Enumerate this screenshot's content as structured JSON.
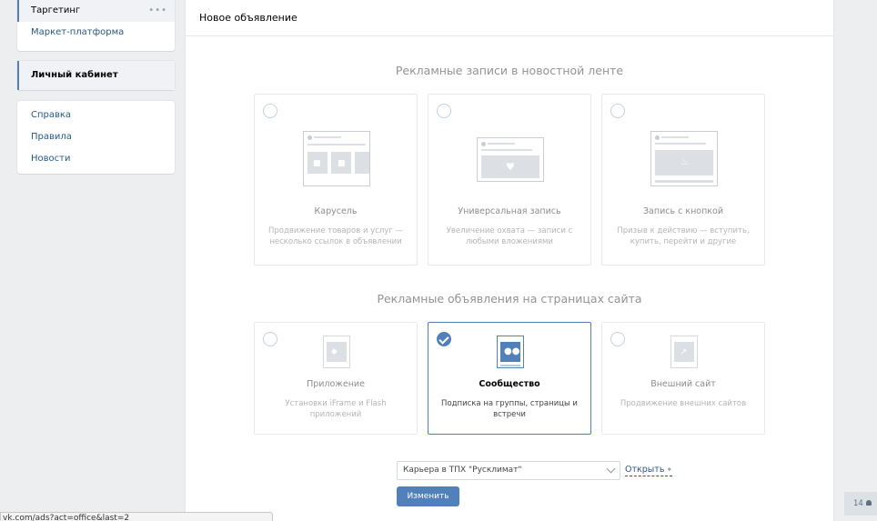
{
  "sidebar": {
    "block1": [
      {
        "label": "Таргетинг",
        "dots": "•••"
      },
      {
        "label": "Маркет-платформа"
      }
    ],
    "block2": [
      {
        "label": "Личный кабинет"
      }
    ],
    "block3": [
      {
        "label": "Справка"
      },
      {
        "label": "Правила"
      },
      {
        "label": "Новости"
      }
    ]
  },
  "header": {
    "title": "Новое объявление"
  },
  "section_feed": {
    "title": "Рекламные записи в новостной ленте",
    "cards": [
      {
        "title": "Карусель",
        "desc": "Продвижение товаров и услуг — несколько ссылок в объявлении",
        "selected": false
      },
      {
        "title": "Универсальная запись",
        "desc": "Увеличение охвата — записи с любыми вложениями",
        "selected": false
      },
      {
        "title": "Запись с кнопкой",
        "desc": "Призыв к действию — вступить, купить, перейти и другие",
        "selected": false
      }
    ]
  },
  "section_site": {
    "title": "Рекламные объявления на страницах сайта",
    "cards": [
      {
        "title": "Приложение",
        "desc": "Установки iFrame и Flash приложений",
        "selected": false
      },
      {
        "title": "Сообщество",
        "desc": "Подписка на группы, страницы и встречи",
        "selected": true
      },
      {
        "title": "Внешний сайт",
        "desc": "Продвижение внешних сайтов",
        "selected": false
      }
    ]
  },
  "controls": {
    "select_value": "Карьера в ТПХ \"Русклимат\"",
    "open_link": "Открыть",
    "button": "Изменить"
  },
  "status_url": "vk.com/ads?act=office&last=2",
  "counter": "14",
  "colors": {
    "accent": "#5181b8",
    "link": "#2a5885",
    "background": "#edeef0"
  }
}
